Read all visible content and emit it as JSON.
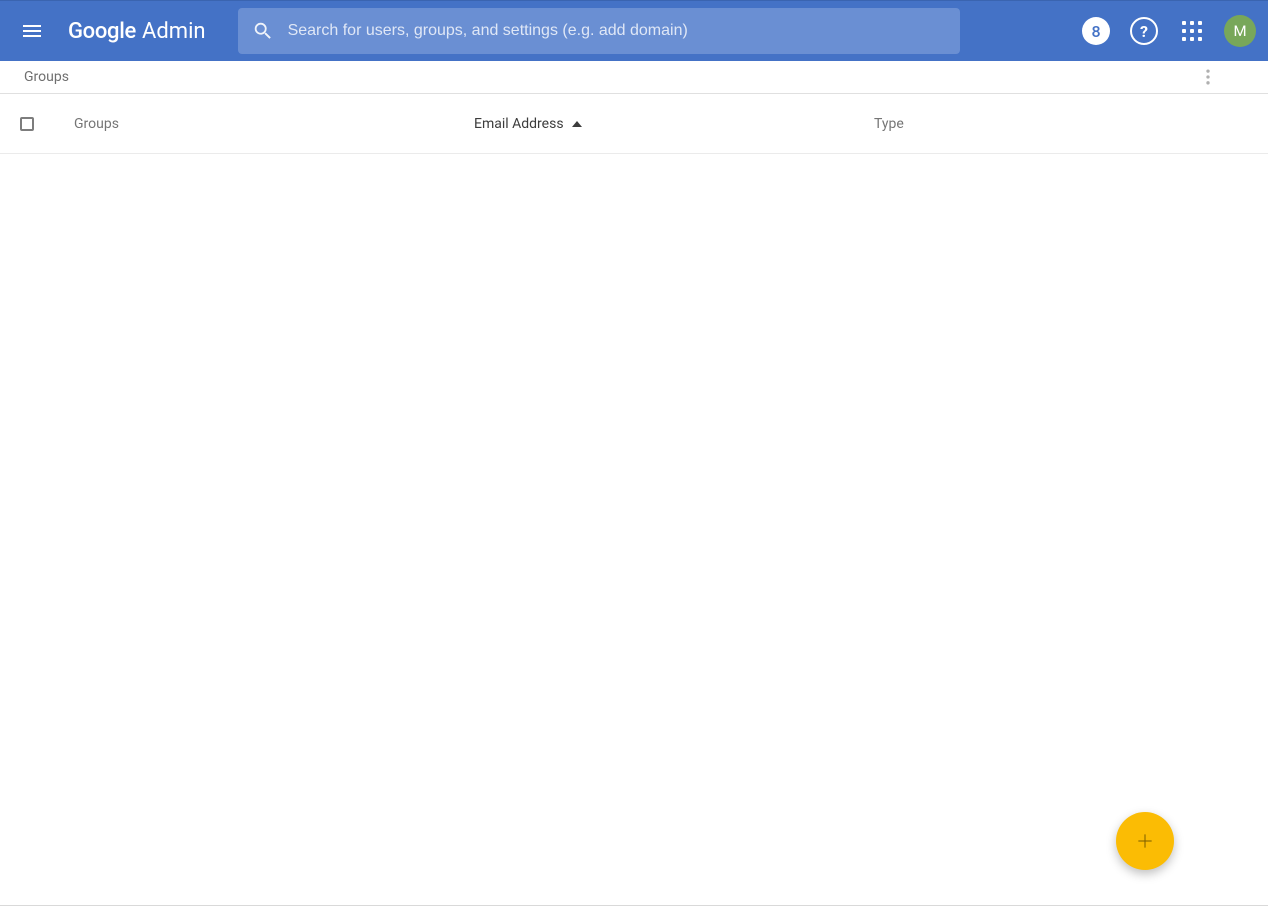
{
  "header": {
    "logo_google": "Google",
    "logo_admin": "Admin",
    "search_placeholder": "Search for users, groups, and settings (e.g. add domain)",
    "notification_badge": "8",
    "avatar_letter": "M"
  },
  "breadcrumb": {
    "label": "Groups"
  },
  "table": {
    "columns": {
      "groups": "Groups",
      "email": "Email Address",
      "type": "Type"
    },
    "sort_column": "email",
    "sort_dir": "asc",
    "rows": []
  },
  "colors": {
    "header_bg": "#4472c6",
    "search_bg": "#6a8fd3",
    "fab_bg": "#fbbc04",
    "avatar_bg": "#78a75a"
  }
}
